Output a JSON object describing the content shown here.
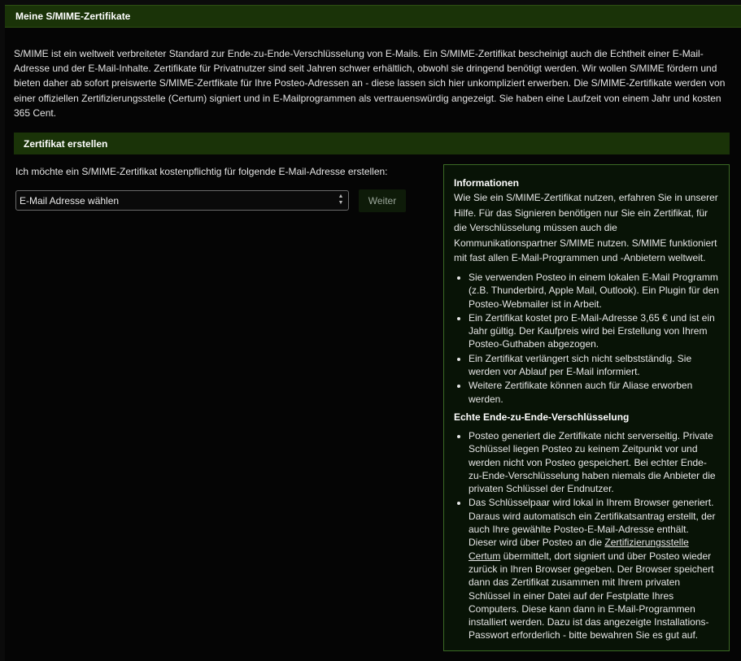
{
  "header": {
    "title": "Meine S/MIME-Zertifikate"
  },
  "intro": {
    "text": "S/MIME ist ein weltweit verbreiteter Standard zur Ende-zu-Ende-Verschlüsselung von E-Mails. Ein S/MIME-Zertifikat bescheinigt auch die Echtheit einer E-Mail-Adresse und der E-Mail-Inhalte. Zertifikate für Privatnutzer sind seit Jahren schwer erhältlich, obwohl sie dringend benötigt werden. Wir wollen S/MIME fördern und bieten daher ab sofort preiswerte S/MIME-Zertfikate für Ihre Posteo-Adressen an - diese lassen sich hier unkompliziert erwerben. Die S/MIME-Zertifikate werden von einer offiziellen Zertifizierungsstelle (Certum) signiert und in E-Mailprogrammen als vertrauenswürdig angezeigt. Sie haben eine Laufzeit von einem Jahr und kosten 365 Cent."
  },
  "create": {
    "section_title": "Zertifikat erstellen",
    "prompt": "Ich möchte ein S/MIME-Zertifikat kostenpflichtig für folgende E-Mail-Adresse erstellen:",
    "select_value": "E-Mail Adresse wählen",
    "next_label": "Weiter"
  },
  "info": {
    "title": "Informationen",
    "intro": "Wie Sie ein S/MIME-Zertifikat nutzen, erfahren Sie in unserer Hilfe. Für das Signieren benötigen nur Sie ein Zertifikat, für die Verschlüsselung müssen auch die Kommunikationspartner S/MIME nutzen. S/MIME funktioniert mit fast allen E-Mail-Programmen und -Anbietern weltweit.",
    "items": [
      "Sie verwenden Posteo in einem lokalen E-Mail Programm (z.B. Thunderbird, Apple Mail, Outlook). Ein Plugin für den Posteo-Webmailer ist in Arbeit.",
      "Ein Zertifikat kostet pro E-Mail-Adresse 3,65 € und ist ein Jahr gültig. Der Kaufpreis wird bei Erstellung von Ihrem Posteo-Guthaben abgezogen.",
      "Ein Zertifikat verlängert sich nicht selbstständig. Sie werden vor Ablauf per E-Mail informiert.",
      "Weitere Zertifikate können auch für Aliase erworben werden."
    ],
    "e2e_title": "Echte Ende-zu-Ende-Verschlüsselung",
    "e2e_item1": "Posteo generiert die Zertifikate nicht serverseitig. Private Schlüssel liegen Posteo zu keinem Zeitpunkt vor und werden nicht von Posteo gespeichert. Bei echter Ende-zu-Ende-Verschlüsselung haben niemals die Anbieter die privaten Schlüssel der Endnutzer.",
    "e2e_item2_before": "Das Schlüsselpaar wird lokal in Ihrem Browser generiert. Daraus wird automatisch ein Zertifikatsantrag erstellt, der auch Ihre gewählte Posteo-E-Mail-Adresse enthält. Dieser wird über Posteo an die ",
    "e2e_item2_link": "Zertifizierungsstelle Certum",
    "e2e_item2_after": " übermittelt, dort signiert und über Posteo wieder zurück in Ihren Browser gegeben. Der Browser speichert dann das Zertifikat zusammen mit Ihrem privaten Schlüssel in einer Datei auf der Festplatte Ihres Computers. Diese kann dann in E-Mail-Programmen installiert werden. Dazu ist das angezeigte Installations-Passwort erforderlich - bitte bewahren Sie es gut auf."
  }
}
